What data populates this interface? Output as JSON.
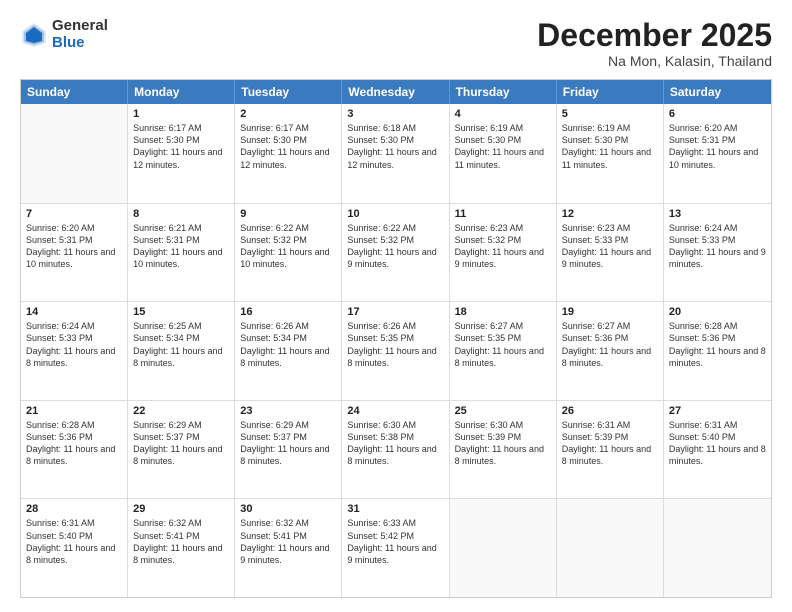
{
  "header": {
    "logo": {
      "general": "General",
      "blue": "Blue"
    },
    "title": "December 2025",
    "location": "Na Mon, Kalasin, Thailand"
  },
  "calendar": {
    "days_of_week": [
      "Sunday",
      "Monday",
      "Tuesday",
      "Wednesday",
      "Thursday",
      "Friday",
      "Saturday"
    ],
    "weeks": [
      [
        {
          "day": "",
          "sunrise": "",
          "sunset": "",
          "daylight": "",
          "empty": true
        },
        {
          "day": "1",
          "sunrise": "Sunrise: 6:17 AM",
          "sunset": "Sunset: 5:30 PM",
          "daylight": "Daylight: 11 hours and 12 minutes."
        },
        {
          "day": "2",
          "sunrise": "Sunrise: 6:17 AM",
          "sunset": "Sunset: 5:30 PM",
          "daylight": "Daylight: 11 hours and 12 minutes."
        },
        {
          "day": "3",
          "sunrise": "Sunrise: 6:18 AM",
          "sunset": "Sunset: 5:30 PM",
          "daylight": "Daylight: 11 hours and 12 minutes."
        },
        {
          "day": "4",
          "sunrise": "Sunrise: 6:19 AM",
          "sunset": "Sunset: 5:30 PM",
          "daylight": "Daylight: 11 hours and 11 minutes."
        },
        {
          "day": "5",
          "sunrise": "Sunrise: 6:19 AM",
          "sunset": "Sunset: 5:30 PM",
          "daylight": "Daylight: 11 hours and 11 minutes."
        },
        {
          "day": "6",
          "sunrise": "Sunrise: 6:20 AM",
          "sunset": "Sunset: 5:31 PM",
          "daylight": "Daylight: 11 hours and 10 minutes."
        }
      ],
      [
        {
          "day": "7",
          "sunrise": "Sunrise: 6:20 AM",
          "sunset": "Sunset: 5:31 PM",
          "daylight": "Daylight: 11 hours and 10 minutes."
        },
        {
          "day": "8",
          "sunrise": "Sunrise: 6:21 AM",
          "sunset": "Sunset: 5:31 PM",
          "daylight": "Daylight: 11 hours and 10 minutes."
        },
        {
          "day": "9",
          "sunrise": "Sunrise: 6:22 AM",
          "sunset": "Sunset: 5:32 PM",
          "daylight": "Daylight: 11 hours and 10 minutes."
        },
        {
          "day": "10",
          "sunrise": "Sunrise: 6:22 AM",
          "sunset": "Sunset: 5:32 PM",
          "daylight": "Daylight: 11 hours and 9 minutes."
        },
        {
          "day": "11",
          "sunrise": "Sunrise: 6:23 AM",
          "sunset": "Sunset: 5:32 PM",
          "daylight": "Daylight: 11 hours and 9 minutes."
        },
        {
          "day": "12",
          "sunrise": "Sunrise: 6:23 AM",
          "sunset": "Sunset: 5:33 PM",
          "daylight": "Daylight: 11 hours and 9 minutes."
        },
        {
          "day": "13",
          "sunrise": "Sunrise: 6:24 AM",
          "sunset": "Sunset: 5:33 PM",
          "daylight": "Daylight: 11 hours and 9 minutes."
        }
      ],
      [
        {
          "day": "14",
          "sunrise": "Sunrise: 6:24 AM",
          "sunset": "Sunset: 5:33 PM",
          "daylight": "Daylight: 11 hours and 8 minutes."
        },
        {
          "day": "15",
          "sunrise": "Sunrise: 6:25 AM",
          "sunset": "Sunset: 5:34 PM",
          "daylight": "Daylight: 11 hours and 8 minutes."
        },
        {
          "day": "16",
          "sunrise": "Sunrise: 6:26 AM",
          "sunset": "Sunset: 5:34 PM",
          "daylight": "Daylight: 11 hours and 8 minutes."
        },
        {
          "day": "17",
          "sunrise": "Sunrise: 6:26 AM",
          "sunset": "Sunset: 5:35 PM",
          "daylight": "Daylight: 11 hours and 8 minutes."
        },
        {
          "day": "18",
          "sunrise": "Sunrise: 6:27 AM",
          "sunset": "Sunset: 5:35 PM",
          "daylight": "Daylight: 11 hours and 8 minutes."
        },
        {
          "day": "19",
          "sunrise": "Sunrise: 6:27 AM",
          "sunset": "Sunset: 5:36 PM",
          "daylight": "Daylight: 11 hours and 8 minutes."
        },
        {
          "day": "20",
          "sunrise": "Sunrise: 6:28 AM",
          "sunset": "Sunset: 5:36 PM",
          "daylight": "Daylight: 11 hours and 8 minutes."
        }
      ],
      [
        {
          "day": "21",
          "sunrise": "Sunrise: 6:28 AM",
          "sunset": "Sunset: 5:36 PM",
          "daylight": "Daylight: 11 hours and 8 minutes."
        },
        {
          "day": "22",
          "sunrise": "Sunrise: 6:29 AM",
          "sunset": "Sunset: 5:37 PM",
          "daylight": "Daylight: 11 hours and 8 minutes."
        },
        {
          "day": "23",
          "sunrise": "Sunrise: 6:29 AM",
          "sunset": "Sunset: 5:37 PM",
          "daylight": "Daylight: 11 hours and 8 minutes."
        },
        {
          "day": "24",
          "sunrise": "Sunrise: 6:30 AM",
          "sunset": "Sunset: 5:38 PM",
          "daylight": "Daylight: 11 hours and 8 minutes."
        },
        {
          "day": "25",
          "sunrise": "Sunrise: 6:30 AM",
          "sunset": "Sunset: 5:39 PM",
          "daylight": "Daylight: 11 hours and 8 minutes."
        },
        {
          "day": "26",
          "sunrise": "Sunrise: 6:31 AM",
          "sunset": "Sunset: 5:39 PM",
          "daylight": "Daylight: 11 hours and 8 minutes."
        },
        {
          "day": "27",
          "sunrise": "Sunrise: 6:31 AM",
          "sunset": "Sunset: 5:40 PM",
          "daylight": "Daylight: 11 hours and 8 minutes."
        }
      ],
      [
        {
          "day": "28",
          "sunrise": "Sunrise: 6:31 AM",
          "sunset": "Sunset: 5:40 PM",
          "daylight": "Daylight: 11 hours and 8 minutes."
        },
        {
          "day": "29",
          "sunrise": "Sunrise: 6:32 AM",
          "sunset": "Sunset: 5:41 PM",
          "daylight": "Daylight: 11 hours and 8 minutes."
        },
        {
          "day": "30",
          "sunrise": "Sunrise: 6:32 AM",
          "sunset": "Sunset: 5:41 PM",
          "daylight": "Daylight: 11 hours and 9 minutes."
        },
        {
          "day": "31",
          "sunrise": "Sunrise: 6:33 AM",
          "sunset": "Sunset: 5:42 PM",
          "daylight": "Daylight: 11 hours and 9 minutes."
        },
        {
          "day": "",
          "sunrise": "",
          "sunset": "",
          "daylight": "",
          "empty": true
        },
        {
          "day": "",
          "sunrise": "",
          "sunset": "",
          "daylight": "",
          "empty": true
        },
        {
          "day": "",
          "sunrise": "",
          "sunset": "",
          "daylight": "",
          "empty": true
        }
      ]
    ]
  }
}
